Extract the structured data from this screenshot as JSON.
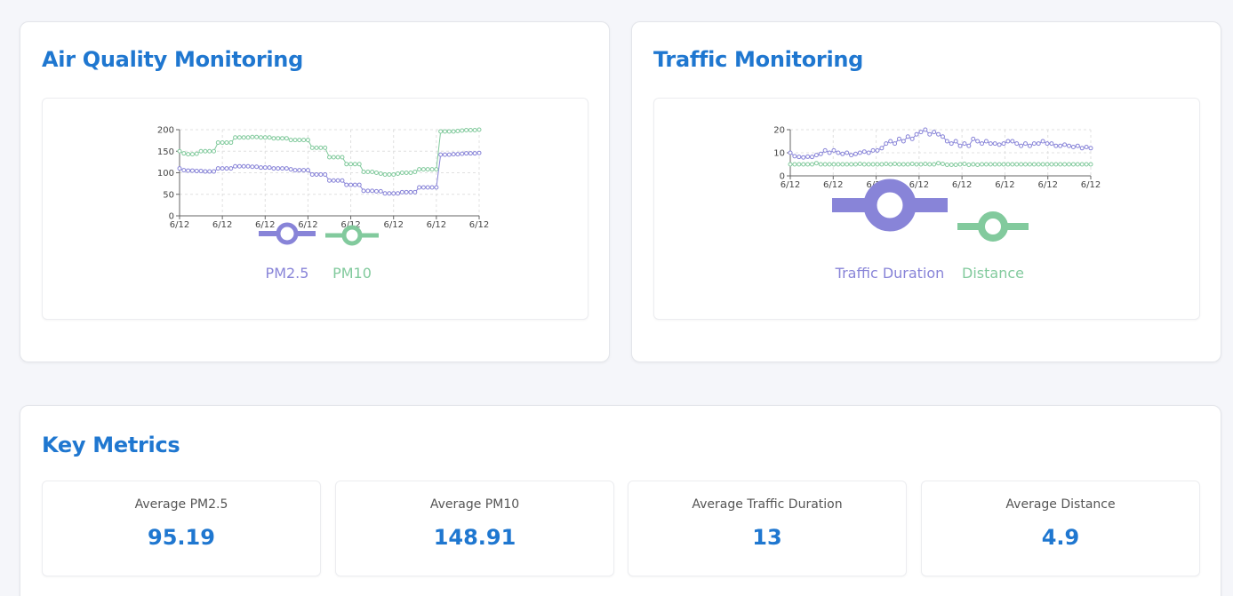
{
  "air_quality": {
    "title": "Air Quality Monitoring",
    "legend": [
      {
        "label": "PM2.5",
        "color": "#8884d8"
      },
      {
        "label": "PM10",
        "color": "#82ca9d"
      }
    ]
  },
  "traffic": {
    "title": "Traffic Monitoring",
    "legend": [
      {
        "label": "Traffic Duration",
        "color": "#8884d8"
      },
      {
        "label": "Distance",
        "color": "#82ca9d"
      }
    ]
  },
  "key_metrics": {
    "title": "Key Metrics",
    "items": [
      {
        "label": "Average PM2.5",
        "value": "95.19"
      },
      {
        "label": "Average PM10",
        "value": "148.91"
      },
      {
        "label": "Average Traffic Duration",
        "value": "13"
      },
      {
        "label": "Average Distance",
        "value": "4.9"
      }
    ]
  },
  "chart_data": [
    {
      "type": "line",
      "name": "air-quality",
      "x_tick_labels": [
        "6/12",
        "6/12",
        "6/12",
        "6/12",
        "6/12",
        "6/12",
        "6/12",
        "6/12"
      ],
      "ylim": [
        0,
        200
      ],
      "y_ticks": [
        0,
        50,
        100,
        150,
        200
      ],
      "grid": true,
      "legend_position": "bottom",
      "series": [
        {
          "name": "PM2.5",
          "color": "#8884d8",
          "values": [
            110,
            106,
            105,
            105,
            104,
            104,
            103,
            103,
            103,
            110,
            110,
            110,
            110,
            115,
            115,
            115,
            115,
            114,
            114,
            112,
            112,
            112,
            110,
            110,
            110,
            110,
            108,
            106,
            106,
            106,
            106,
            96,
            96,
            96,
            96,
            82,
            82,
            82,
            82,
            72,
            72,
            72,
            72,
            58,
            58,
            58,
            57,
            57,
            52,
            52,
            52,
            52,
            55,
            55,
            55,
            55,
            66,
            66,
            66,
            66,
            66,
            142,
            142,
            142,
            143,
            143,
            144,
            145,
            145,
            145,
            146
          ]
        },
        {
          "name": "PM10",
          "color": "#82ca9d",
          "values": [
            150,
            145,
            143,
            143,
            144,
            150,
            150,
            150,
            150,
            170,
            170,
            170,
            170,
            182,
            182,
            182,
            182,
            183,
            183,
            182,
            182,
            182,
            180,
            180,
            180,
            180,
            176,
            176,
            176,
            176,
            176,
            158,
            158,
            158,
            158,
            136,
            136,
            136,
            136,
            120,
            120,
            120,
            120,
            102,
            102,
            102,
            100,
            98,
            96,
            96,
            96,
            98,
            100,
            100,
            100,
            102,
            108,
            108,
            108,
            108,
            108,
            196,
            196,
            196,
            196,
            197,
            198,
            199,
            199,
            199,
            200
          ]
        }
      ]
    },
    {
      "type": "line",
      "name": "traffic",
      "x_tick_labels": [
        "6/12",
        "6/12",
        "6/12",
        "6/12",
        "6/12",
        "6/12",
        "6/12",
        "6/12"
      ],
      "ylim": [
        0,
        20
      ],
      "y_ticks": [
        0,
        10,
        20
      ],
      "grid": true,
      "legend_position": "bottom",
      "series": [
        {
          "name": "Traffic Duration",
          "color": "#8884d8",
          "values": [
            10,
            8.5,
            8.2,
            8,
            8.3,
            8.2,
            9,
            9.5,
            11,
            10,
            11,
            10,
            9.5,
            10,
            9,
            9.5,
            10,
            10.5,
            10,
            11,
            11,
            12,
            14,
            15,
            14,
            16,
            15,
            17,
            16,
            18,
            19,
            20,
            18,
            19,
            18,
            17,
            15,
            14,
            15,
            13,
            14,
            13,
            16,
            15,
            14,
            15,
            14,
            14,
            13.5,
            14,
            15,
            15,
            14,
            13,
            14,
            13,
            14,
            14,
            15,
            14,
            14,
            13,
            13,
            13.5,
            13,
            12.5,
            13,
            12,
            12.5,
            12
          ]
        },
        {
          "name": "Distance",
          "color": "#82ca9d",
          "values": [
            5,
            5,
            5,
            5,
            5,
            5,
            5.5,
            5,
            5,
            5,
            5,
            5,
            5,
            5,
            5,
            5,
            5.2,
            5,
            5,
            5,
            5,
            5,
            5.2,
            5,
            5.2,
            5,
            5,
            5,
            5.2,
            5,
            5,
            5.2,
            5,
            5,
            5.5,
            5.2,
            4.8,
            4.8,
            4.8,
            5,
            5.2,
            4.8,
            5,
            4.8,
            5,
            5,
            5,
            5,
            5,
            5,
            5,
            5,
            5,
            5,
            5,
            5,
            5,
            5,
            5,
            5,
            5,
            5,
            5,
            5,
            5,
            5,
            5,
            5,
            5,
            5
          ]
        }
      ]
    }
  ]
}
